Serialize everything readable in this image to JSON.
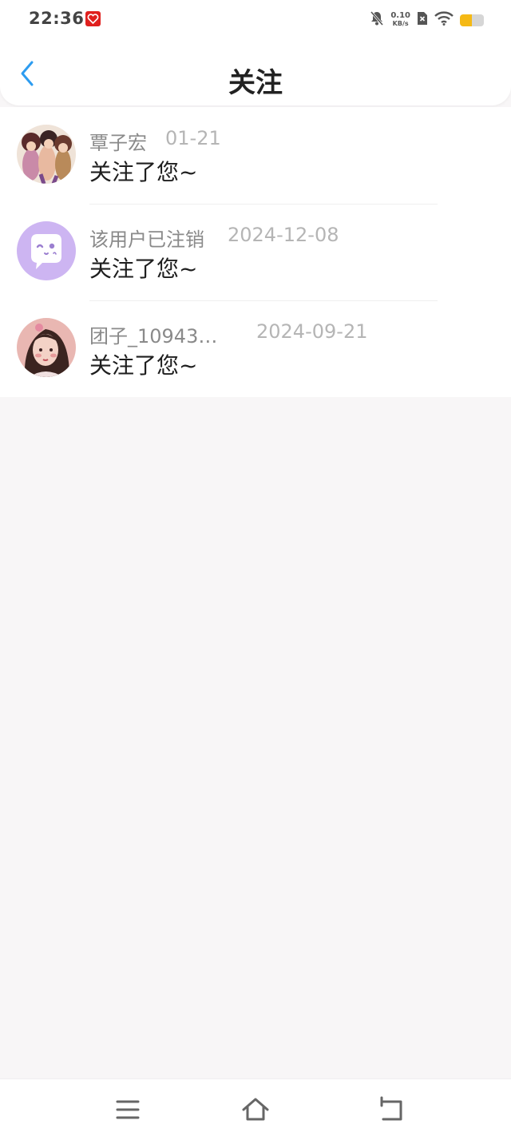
{
  "status_bar": {
    "time": "22:36",
    "app_icon": "red-heart-app-icon",
    "net_speed_value": "0.10",
    "net_speed_unit": "KB/s",
    "battery_color": "#f5b915",
    "battery_level": 0.5,
    "icons": [
      "bell-muted-icon",
      "sim-disabled-icon",
      "wifi-icon",
      "battery-icon"
    ]
  },
  "header": {
    "back_icon": "chevron-left-icon",
    "title": "关注",
    "accent_color": "#2d9cf0"
  },
  "items": [
    {
      "name": "覃子宏",
      "date": "01-21",
      "message": "关注了您~",
      "avatar": "anime-group-avatar"
    },
    {
      "name": "该用户已注销",
      "date": "2024-12-08",
      "message": "关注了您~",
      "avatar": "deleted-user-avatar"
    },
    {
      "name": "团子_10943…",
      "date": "2024-09-21",
      "message": "关注了您~",
      "avatar": "girl-portrait-avatar"
    }
  ],
  "nav_bar": {
    "buttons": [
      "menu-icon",
      "home-icon",
      "back-icon"
    ]
  }
}
